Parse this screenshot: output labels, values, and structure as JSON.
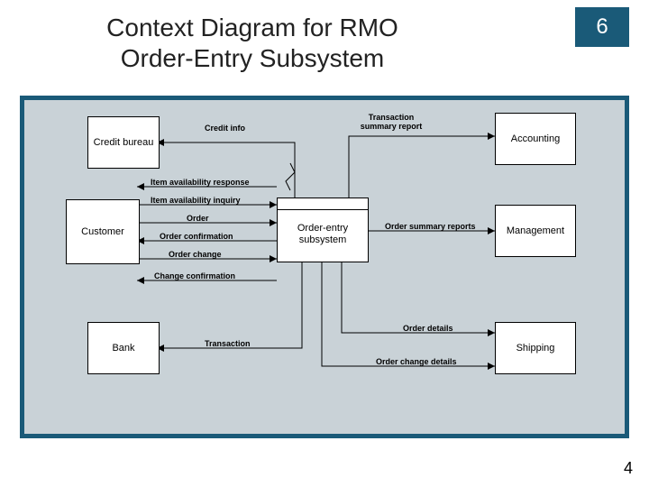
{
  "slide": {
    "title_line1": "Context Diagram for RMO",
    "title_line2": "Order-Entry Subsystem",
    "chapter_number": "6",
    "page_number": "4"
  },
  "process": {
    "name": "Order-entry subsystem"
  },
  "entities": {
    "credit_bureau": "Credit bureau",
    "customer": "Customer",
    "bank": "Bank",
    "accounting": "Accounting",
    "management": "Management",
    "shipping": "Shipping"
  },
  "flows": {
    "credit_info": "Credit info",
    "item_avail_response": "Item availability response",
    "item_avail_inquiry": "Item availability inquiry",
    "order": "Order",
    "order_confirmation": "Order confirmation",
    "order_change": "Order change",
    "change_confirmation": "Change confirmation",
    "transaction": "Transaction",
    "transaction_summary_report": "Transaction summary report",
    "order_summary_reports": "Order summary reports",
    "order_details": "Order details",
    "order_change_details": "Order change details"
  }
}
